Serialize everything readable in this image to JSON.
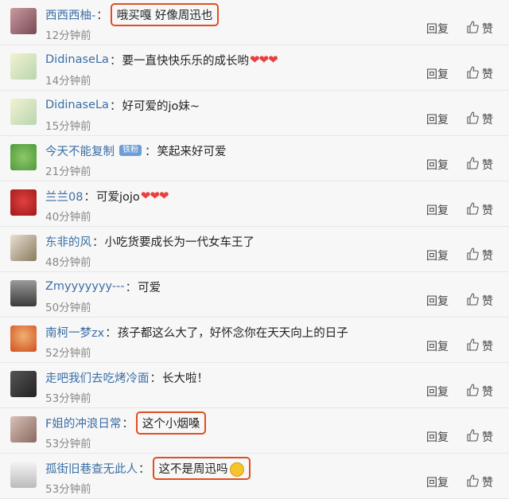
{
  "comments": [
    {
      "user": "西西西柚-",
      "text": "哦买嘎 好像周迅也",
      "time": "12分钟前"
    },
    {
      "user": "DidinaseLa",
      "text": "要一直快快乐乐的成长哟",
      "hearts": "❤❤❤",
      "time": "14分钟前"
    },
    {
      "user": "DidinaseLa",
      "text": "好可爱的jo妹~",
      "time": "15分钟前"
    },
    {
      "user": "今天不能复制",
      "badge": "铁粉",
      "text": "笑起来好可爱",
      "time": "21分钟前"
    },
    {
      "user": "兰兰08",
      "text": "可爱jojo",
      "hearts": "❤❤❤",
      "time": "40分钟前"
    },
    {
      "user": "东非的风",
      "text": "小吃货要成长为一代女车王了",
      "time": "48分钟前"
    },
    {
      "user": "Zmyyyyyyy---",
      "text": "可爱",
      "time": "50分钟前"
    },
    {
      "user": "南柯一梦zx",
      "text": "孩子都这么大了，好怀念你在天天向上的日子",
      "time": "52分钟前"
    },
    {
      "user": "走吧我们去吃烤冷面",
      "text": "长大啦！",
      "time": "53分钟前"
    },
    {
      "user": "F姐的冲浪日常",
      "text": "这个小烟嗓",
      "time": "53分钟前"
    },
    {
      "user": "孤街旧巷查无此人",
      "text": "这不是周迅吗",
      "time": "53分钟前"
    }
  ],
  "actions": {
    "reply": "回复",
    "like": "赞"
  },
  "colors": {
    "username": "#3a6ea5",
    "highlight_border": "#e04f1f",
    "badge": "#6b9ed8",
    "heart": "#ea3f3f"
  }
}
